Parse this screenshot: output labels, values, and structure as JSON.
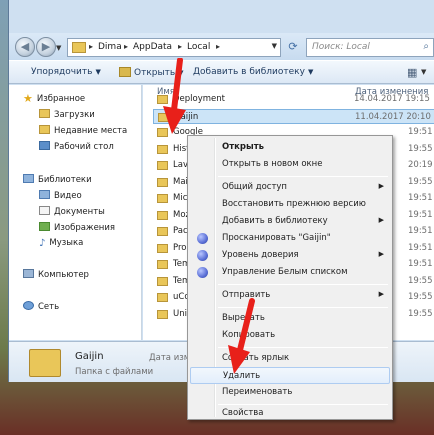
{
  "address_bar": {
    "crumbs": [
      "Dima",
      "AppData",
      "Local"
    ],
    "search_placeholder": "Поиск: Local"
  },
  "toolbar": {
    "organize": "Упорядочить",
    "open": "Открыть",
    "add_to_library": "Добавить в библиотеку"
  },
  "sidebar": {
    "favorites": "Избранное",
    "downloads": "Загрузки",
    "recent": "Недавние места",
    "desktop": "Рабочий стол",
    "libraries": "Библиотеки",
    "video": "Видео",
    "documents": "Документы",
    "images": "Изображения",
    "music": "Музыка",
    "computer": "Компьютер",
    "network": "Сеть"
  },
  "filelist": {
    "col_name": "Имя",
    "col_date": "Дата изменения",
    "rows": [
      {
        "name": "Deployment",
        "date": "14.04.2017 19:15"
      },
      {
        "name": "Gaijin",
        "date": "11.04.2017 20:10",
        "selected": true
      },
      {
        "name": "Google",
        "date": "19:51"
      },
      {
        "name": "History",
        "date": "19:55"
      },
      {
        "name": "Lavasoft",
        "date": "20:19"
      },
      {
        "name": "Mail.Ru",
        "date": "19:55"
      },
      {
        "name": "Microsoft",
        "date": "19:51"
      },
      {
        "name": "Mozilla",
        "date": "19:51"
      },
      {
        "name": "Packages",
        "date": "19:51"
      },
      {
        "name": "Programs",
        "date": "19:51"
      },
      {
        "name": "Temp",
        "date": "19:51"
      },
      {
        "name": "Temporary",
        "date": "19:55"
      },
      {
        "name": "uCozMedia",
        "date": "19:55"
      },
      {
        "name": "Unity",
        "date": "19:55"
      }
    ]
  },
  "details": {
    "name": "Gaijin",
    "type": "Папка с файлами",
    "date_label": "Дата измене"
  },
  "context_menu": {
    "open": "Открыть",
    "open_new_window": "Открыть в новом окне",
    "share": "Общий доступ",
    "restore_prev": "Восстановить прежнюю версию",
    "add_to_library": "Добавить в библиотеку",
    "scan": "Просканировать \"Gaijin\"",
    "trust_level": "Уровень доверия",
    "whitelist": "Управление Белым списком",
    "send_to": "Отправить",
    "cut": "Вырезать",
    "copy": "Копировать",
    "create_shortcut": "Создать ярлык",
    "delete": "Удалить",
    "rename": "Переименовать",
    "properties": "Свойства"
  },
  "colors": {
    "arrow": "#e8201a",
    "selection": "#cce4f7",
    "menu_bg": "#f0f0f0"
  }
}
